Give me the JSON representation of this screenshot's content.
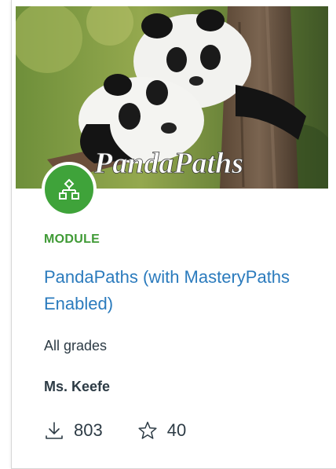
{
  "hero": {
    "image_text": "PandaPaths"
  },
  "badge": {
    "icon": "module-icon",
    "color": "#3fa33a"
  },
  "card": {
    "type_label": "MODULE",
    "title": "PandaPaths (with MasteryPaths Enabled)",
    "grades": "All grades",
    "author": "Ms. Keefe"
  },
  "stats": {
    "downloads": "803",
    "favorites": "40"
  },
  "colors": {
    "label_green": "#3f9a35",
    "link_blue": "#2b7bbd",
    "text_dark": "#2d3b45"
  }
}
